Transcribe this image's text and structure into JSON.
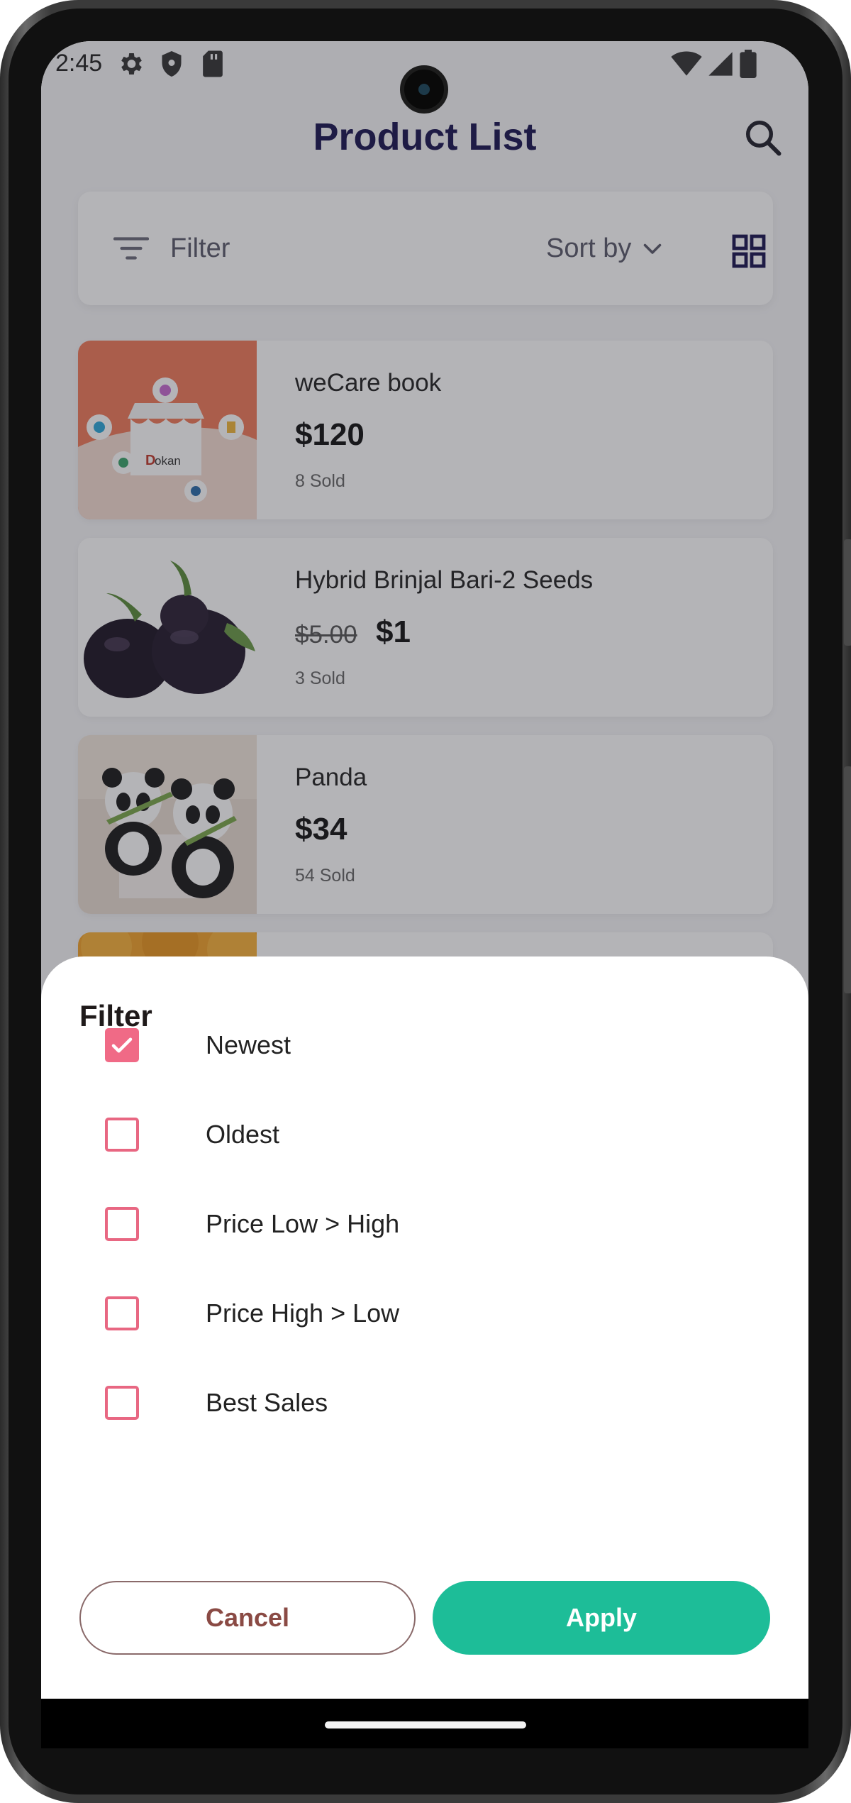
{
  "status_bar": {
    "time": "2:45",
    "icons": [
      "settings-icon",
      "shield-icon",
      "sd-card-icon",
      "wifi-icon",
      "signal-icon",
      "battery-icon"
    ]
  },
  "app_bar": {
    "title": "Product List",
    "search_icon": "search-icon"
  },
  "toolbar": {
    "filter_label": "Filter",
    "sort_label": "Sort by",
    "view_icon": "grid-view-icon"
  },
  "products": [
    {
      "name": "weCare book",
      "price": "$120",
      "old_price": "",
      "sold": "8 Sold",
      "image": "dokan-store-image"
    },
    {
      "name": "Hybrid Brinjal Bari-2 Seeds",
      "price": "$1",
      "old_price": "$5.00",
      "sold": "3 Sold",
      "image": "eggplant-image"
    },
    {
      "name": "Panda",
      "price": "$34",
      "old_price": "",
      "sold": "54 Sold",
      "image": "panda-toy-image"
    }
  ],
  "filter_sheet": {
    "title": "Filter",
    "options": [
      {
        "label": "Newest",
        "checked": true
      },
      {
        "label": "Oldest",
        "checked": false
      },
      {
        "label": "Price Low > High",
        "checked": false
      },
      {
        "label": "Price High > Low",
        "checked": false
      },
      {
        "label": "Best Sales",
        "checked": false
      }
    ],
    "cancel_label": "Cancel",
    "apply_label": "Apply"
  },
  "colors": {
    "title": "#1a1450",
    "checkbox": "#f06a86",
    "apply": "#1dbd98",
    "cancel_text": "#8a4a44"
  }
}
